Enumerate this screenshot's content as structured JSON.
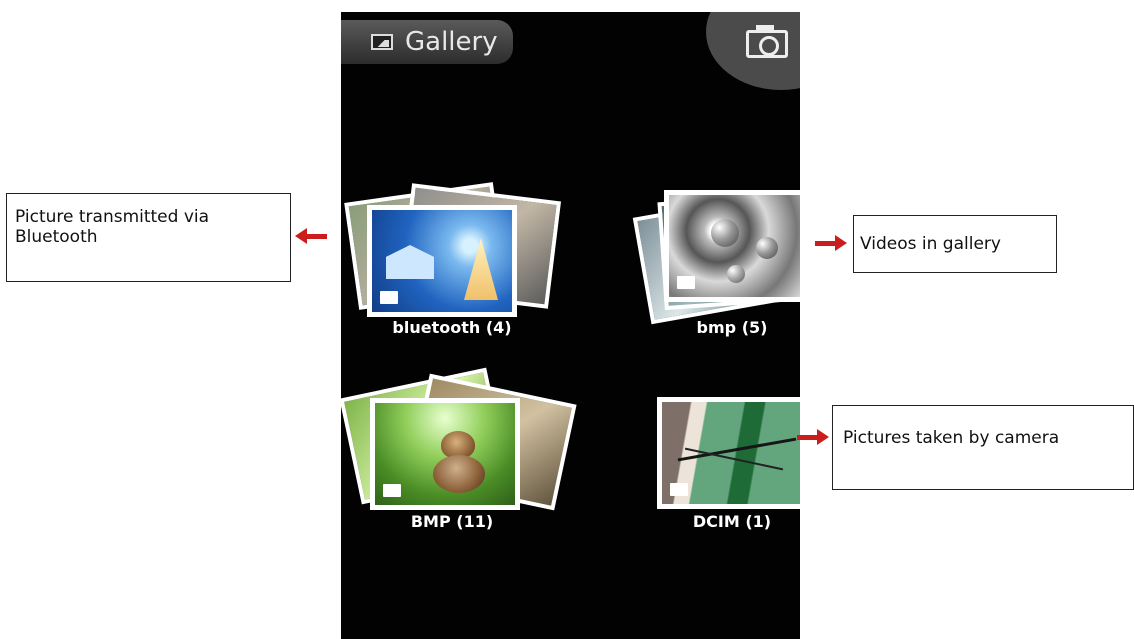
{
  "app": {
    "title": "Gallery",
    "gallery_icon": "gallery-icon",
    "camera_icon": "camera-icon"
  },
  "albums": [
    {
      "label": "bluetooth (4)"
    },
    {
      "label": "bmp (5)"
    },
    {
      "label": "BMP (11)"
    },
    {
      "label": "DCIM (1)"
    }
  ],
  "annotations": [
    {
      "text": "Picture transmitted via Bluetooth"
    },
    {
      "text": "Videos in gallery"
    },
    {
      "text": "Pictures taken by camera"
    }
  ],
  "colors": {
    "arrow": "#cc1d1d",
    "background": "#020202"
  }
}
